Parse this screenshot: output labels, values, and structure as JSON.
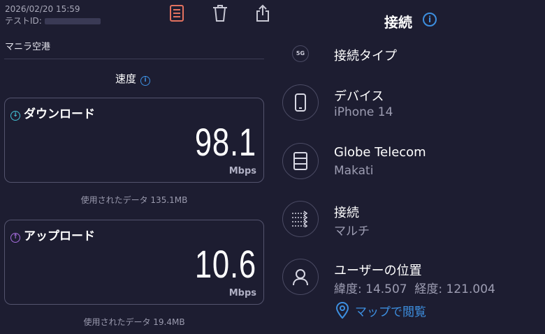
{
  "left": {
    "datetime": "2026/02/20 15:59",
    "test_id_label": "テストID:",
    "location": "マニラ空港",
    "speed_title": "速度",
    "download": {
      "label": "ダウンロード",
      "value": "98.1",
      "unit": "Mbps",
      "data_used": "使用されたデータ 135.1MB"
    },
    "upload": {
      "label": "アップロード",
      "value": "10.6",
      "unit": "Mbps",
      "data_used": "使用されたデータ 19.4MB"
    },
    "icons": [
      "list-icon",
      "trash-icon",
      "share-icon"
    ],
    "colors": {
      "active_icon": "#e2715f",
      "download_accent": "#43c3d6",
      "upload_accent": "#a86ee0"
    }
  },
  "right": {
    "title": "接続",
    "connection_type": {
      "icon_text": "5G",
      "label": "接続タイプ"
    },
    "device": {
      "label": "デバイス",
      "value": "iPhone 14"
    },
    "provider": {
      "label": "Globe Telecom",
      "value": "Makati"
    },
    "connection": {
      "label": "接続",
      "value": "マルチ"
    },
    "user_location": {
      "label": "ユーザーの位置",
      "value": "緯度: 14.507  経度: 121.004"
    },
    "map_link": "マップで閲覧",
    "colors": {
      "link": "#3d8fe0"
    }
  }
}
